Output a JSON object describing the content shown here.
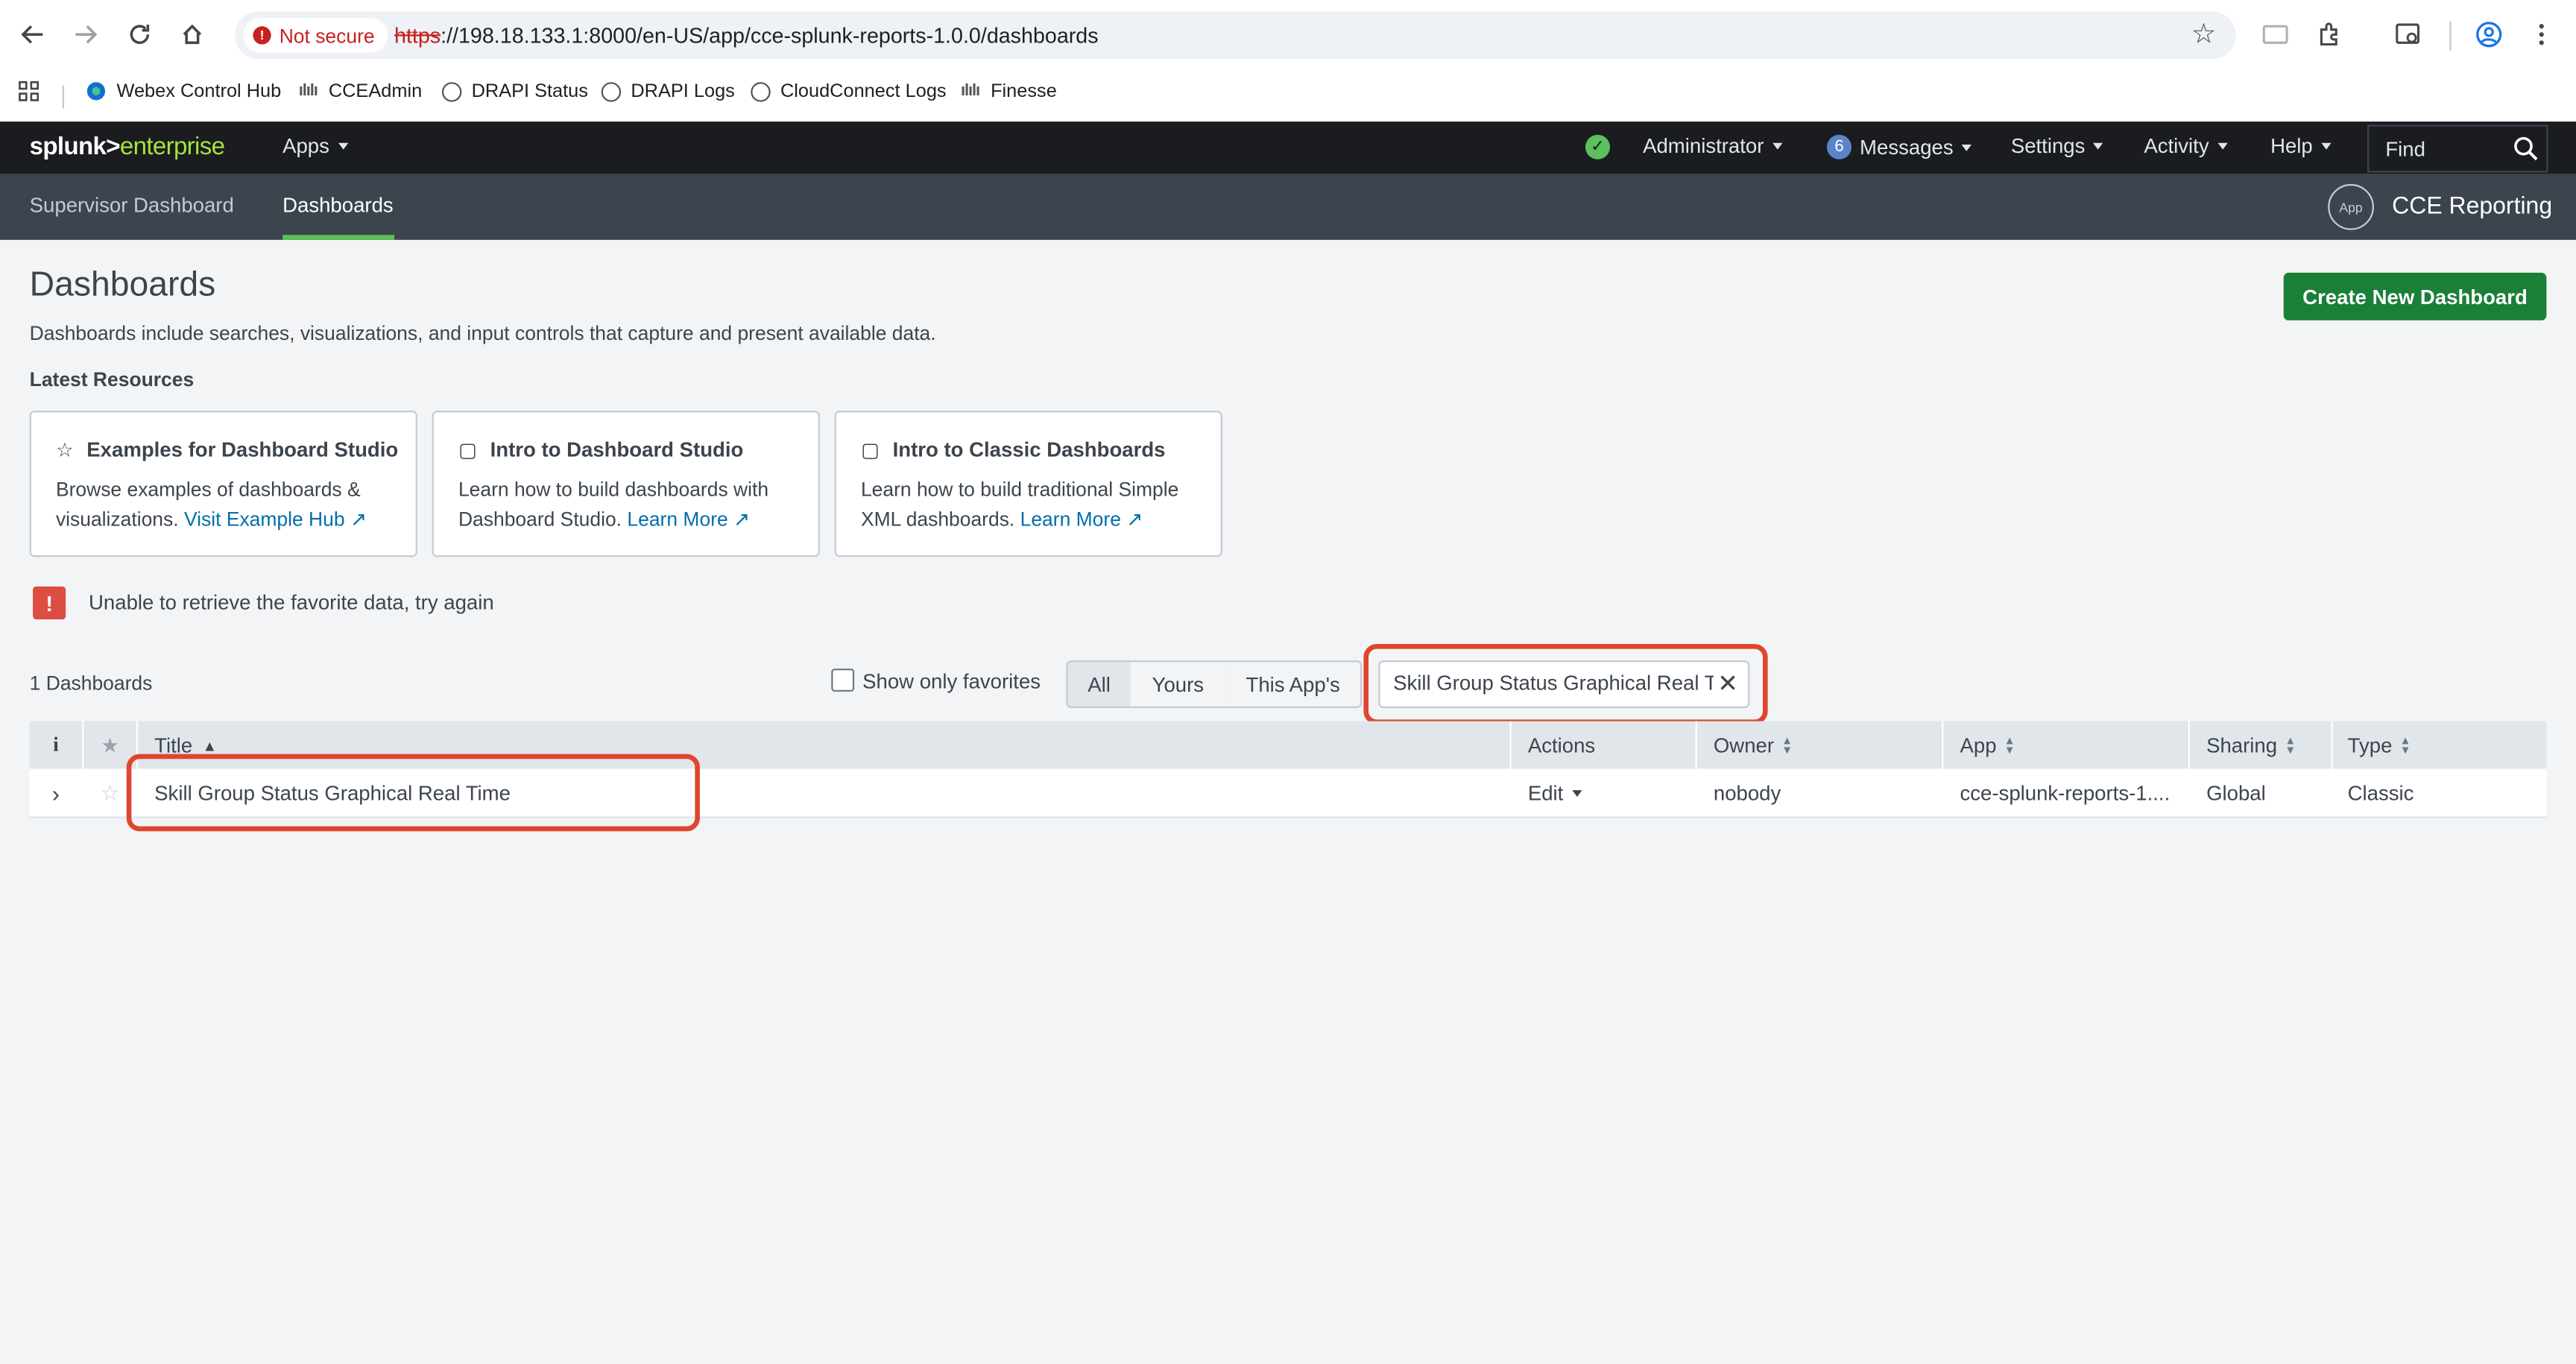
{
  "browser": {
    "not_secure_label": "Not secure",
    "url_scheme": "https",
    "url_rest": "://198.18.133.1:8000/en-US/app/cce-splunk-reports-1.0.0/dashboards",
    "bookmarks": [
      "Webex Control Hub",
      "CCEAdmin",
      "DRAPI Status",
      "DRAPI Logs",
      "CloudConnect Logs",
      "Finesse"
    ]
  },
  "splunk_header": {
    "logo_main": "splunk>",
    "logo_suffix": "enterprise",
    "apps_label": "Apps",
    "admin_label": "Administrator",
    "messages_count": "6",
    "messages_label": "Messages",
    "settings_label": "Settings",
    "activity_label": "Activity",
    "help_label": "Help",
    "find_placeholder": "Find"
  },
  "app_bar": {
    "nav": [
      "Supervisor Dashboard",
      "Dashboards"
    ],
    "active": "Dashboards",
    "app_icon_label": "App",
    "app_name": "CCE Reporting"
  },
  "page": {
    "title": "Dashboards",
    "description": "Dashboards include searches, visualizations, and input controls that capture and present available data.",
    "latest_resources": "Latest Resources",
    "create_button": "Create New Dashboard"
  },
  "cards": [
    {
      "title": "Examples for Dashboard Studio",
      "body": "Browse examples of dashboards & visualizations.",
      "link": "Visit Example Hub"
    },
    {
      "title": "Intro to Dashboard Studio",
      "body": "Learn how to build dashboards with Dashboard Studio.",
      "link": "Learn More"
    },
    {
      "title": "Intro to Classic Dashboards",
      "body": "Learn how to build traditional Simple XML dashboards.",
      "link": "Learn More"
    }
  ],
  "error": {
    "message": "Unable to retrieve the favorite data, try again"
  },
  "list_controls": {
    "count_label": "1 Dashboards",
    "favorites_label": "Show only favorites",
    "segments": [
      "All",
      "Yours",
      "This App's"
    ],
    "active_segment": "All",
    "filter_value": "Skill Group Status Graphical Real Time"
  },
  "table": {
    "headers": [
      "i",
      "Title",
      "Actions",
      "Owner",
      "App",
      "Sharing",
      "Type"
    ],
    "rows": [
      {
        "title": "Skill Group Status Graphical Real Time",
        "action": "Edit",
        "owner": "nobody",
        "app": "cce-splunk-reports-1....",
        "sharing": "Global",
        "type": "Classic"
      }
    ]
  },
  "colors": {
    "splunk_bar": "#1a1c20",
    "app_bar": "#3c444d",
    "accent_green": "#5cc05c",
    "create_button": "#1a7f37",
    "link": "#006eaa",
    "error": "#dc4e41",
    "highlight": "#e0452d"
  }
}
